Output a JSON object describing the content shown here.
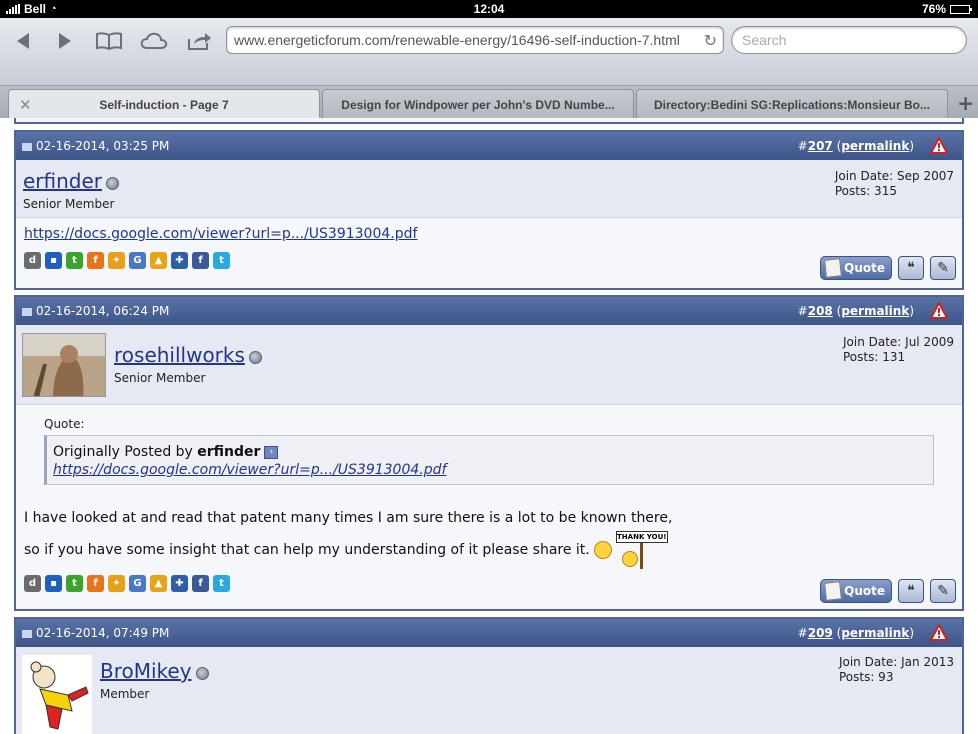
{
  "status_bar": {
    "carrier": "Bell",
    "time": "12:04",
    "battery": "76%",
    "battery_level": 0.76
  },
  "toolbar": {
    "url": "www.energeticforum.com/renewable-energy/16496-self-induction-7.html",
    "search_placeholder": "Search"
  },
  "tabs": [
    {
      "label": "Self-induction - Page 7",
      "active": true
    },
    {
      "label": "Design for Windpower per John's DVD Numbe...",
      "active": false
    },
    {
      "label": "Directory:Bedini SG:Replications:Monsieur Bo...",
      "active": false
    }
  ],
  "posts": [
    {
      "date": "02-16-2014, 03:25 PM",
      "hash": "#",
      "number": "207",
      "permalink": "permalink",
      "open_paren": "(",
      "close_paren": ")",
      "username": "erfinder",
      "title": "Senior Member",
      "join_date": "Join Date: Sep 2007",
      "posts": "Posts: 315",
      "link": "https://docs.google.com/viewer?url=p.../US3913004.pdf",
      "quote_button": "Quote"
    },
    {
      "date": "02-16-2014, 06:24 PM",
      "hash": "#",
      "number": "208",
      "permalink": "permalink",
      "open_paren": "(",
      "close_paren": ")",
      "username": "rosehillworks",
      "title": "Senior Member",
      "join_date": "Join Date: Jul 2009",
      "posts": "Posts: 131",
      "quote_label": "Quote:",
      "quote_prefix": "Originally Posted by",
      "quote_author": "erfinder",
      "quote_link": "https://docs.google.com/viewer?url=p.../US3913004.pdf",
      "message_line1": "I have looked at and read that patent many times I am sure there is a lot to be known there,",
      "message_line2": "so if you have some insight that can help my understanding of it please share it.",
      "thank_you": "THANK YOU!",
      "quote_button": "Quote"
    },
    {
      "date": "02-16-2014, 07:49 PM",
      "hash": "#",
      "number": "209",
      "permalink": "permalink",
      "open_paren": "(",
      "close_paren": ")",
      "username": "BroMikey",
      "title": "Member",
      "join_date": "Join Date: Jan 2013",
      "posts": "Posts: 93"
    }
  ],
  "bookmark_icons": [
    {
      "name": "digg-icon",
      "glyph": "d",
      "color": "#6b6b6b"
    },
    {
      "name": "delicious-icon",
      "glyph": "▪",
      "color": "#1f5fbf"
    },
    {
      "name": "technorati-icon",
      "glyph": "t",
      "color": "#3aa52a"
    },
    {
      "name": "furl-icon",
      "glyph": "f",
      "color": "#e8731a"
    },
    {
      "name": "windows-live-icon",
      "glyph": "✦",
      "color": "#e8a01a"
    },
    {
      "name": "google-icon",
      "glyph": "G",
      "color": "#4a78c8"
    },
    {
      "name": "yahoo-icon",
      "glyph": "▲",
      "color": "#e6a514"
    },
    {
      "name": "myspace-icon",
      "glyph": "✚",
      "color": "#2f5ea8"
    },
    {
      "name": "facebook-icon",
      "glyph": "f",
      "color": "#3b5998"
    },
    {
      "name": "twitter-icon",
      "glyph": "t",
      "color": "#29a9df"
    }
  ]
}
